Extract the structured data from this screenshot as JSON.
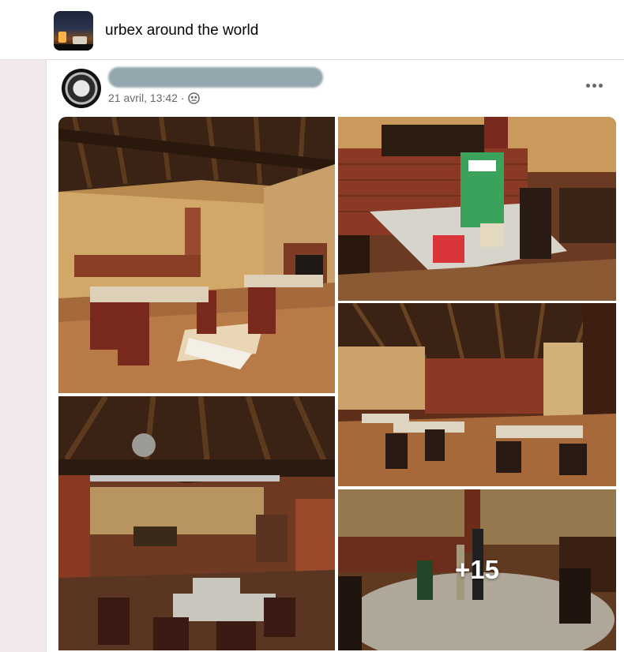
{
  "group": {
    "name": "urbex around the world",
    "avatar_icon": "group-cover-photo"
  },
  "post": {
    "timestamp": "21 avril, 13:42",
    "separator": "·",
    "audience_icon": "group-members-icon",
    "more_icon": "more-options-icon",
    "photos": [
      {
        "name": "photo-dining-room-overview",
        "subject": "abandoned restaurant dining room with wooden ceiling beams"
      },
      {
        "name": "photo-table-closeup",
        "subject": "marble table with tea box display"
      },
      {
        "name": "photo-stage-area",
        "subject": "dining room with disco ball and lighting truss"
      },
      {
        "name": "photo-wide-dining-hall",
        "subject": "dining hall with wooden beams"
      },
      {
        "name": "photo-more",
        "subject": "round table with bottles"
      }
    ],
    "more_count_label": "+15"
  },
  "colors": {
    "page_bg": "#f0f2f5",
    "card_bg": "#ffffff",
    "meta_text": "#65676b",
    "left_strip": "#f2e9ee"
  }
}
